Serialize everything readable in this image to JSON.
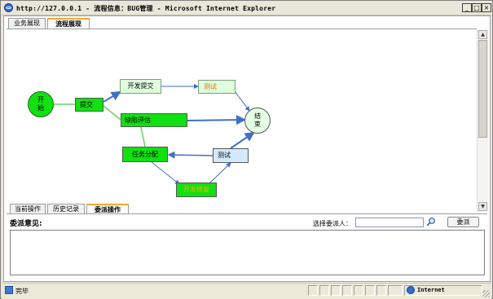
{
  "window": {
    "title": "http://127.0.0.1 - 流程信息：BUG管理 - Microsoft Internet Explorer",
    "min_glyph": "_",
    "max_glyph": "□",
    "close_glyph": "×"
  },
  "top_tabs": [
    {
      "label": "业务展现",
      "active": false
    },
    {
      "label": "流程展现",
      "active": true
    }
  ],
  "flow": {
    "nodes": {
      "start": "开始",
      "submit": "提交",
      "dev_submit": "开发提交",
      "test1": "测试",
      "defect_eval": "缺陷评估",
      "end": "结束",
      "task_assign": "任务分配",
      "test2": "测试",
      "fix": "开发修复"
    },
    "colors": {
      "active_node": "#11e011",
      "pending_node": "#dfffde",
      "current_node": "#d4eafc",
      "blue_edge": "#3f6fc8",
      "green_edge": "#66d466"
    }
  },
  "bottom_tabs": [
    {
      "label": "当前操作",
      "active": false
    },
    {
      "label": "历史记录",
      "active": false
    },
    {
      "label": "委派操作",
      "active": true
    }
  ],
  "assign_panel": {
    "opinion_label": "委派意见:",
    "assignee_label": "选择委派人：",
    "assignee_value": "",
    "assign_button": "委派",
    "search_icon": "magnifier-icon"
  },
  "statusbar": {
    "status": "完毕",
    "zone": "Internet"
  }
}
